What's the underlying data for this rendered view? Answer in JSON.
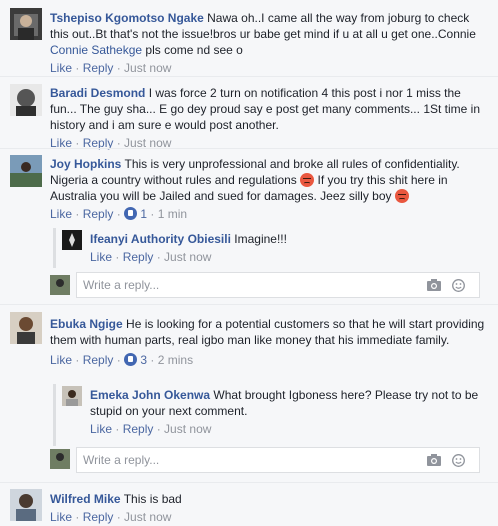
{
  "comments": [
    {
      "name": "Tshepiso Kgomotso Ngake",
      "text": "Nawa oh..I came all the way from joburg to check this out..Bt that's not the issue!bros ur babe get mind if u at all u get one..Connie",
      "mention": "Connie Sathekge",
      "text_after": "pls come nd see o",
      "like": "Like",
      "reply": "Reply",
      "time": "Just now"
    },
    {
      "name": "Baradi Desmond",
      "text": "I was force 2 turn on notification 4 this post i nor 1 miss the fun... The guy sha... E go dey proud say e post get many comments... 1St time in history and i am sure e would post another.",
      "like": "Like",
      "reply": "Reply",
      "time": "Just now"
    },
    {
      "name": "Joy Hopkins",
      "text_a": "This is very unprofessional and broke all rules of confidentiality. Nigeria a country without rules and regulations",
      "text_b": "If you try this shit here in Australia you will be Jailed and sued for damages. Jeez silly boy",
      "like": "Like",
      "reply": "Reply",
      "reactions": "1",
      "time": "1 min",
      "replies": [
        {
          "name": "Ifeanyi Authority Obiesili",
          "text": "Imagine!!!",
          "like": "Like",
          "reply": "Reply",
          "time": "Just now"
        }
      ],
      "reply_placeholder": "Write a reply..."
    },
    {
      "name": "Ebuka Ngige",
      "text": "He is looking for a potential customers so that he will start providing them with human parts, real igbo man like money that his immediate family.",
      "like": "Like",
      "reply": "Reply",
      "reactions": "3",
      "time": "2 mins",
      "replies": [
        {
          "name": "Emeka John Okenwa",
          "text": "What brought Igboness here? Please try not to be stupid on your next comment.",
          "like": "Like",
          "reply": "Reply",
          "time": "Just now"
        }
      ],
      "reply_placeholder": "Write a reply..."
    },
    {
      "name": "Wilfred Mike",
      "text": "This is bad",
      "like": "Like",
      "reply": "Reply",
      "time": "Just now"
    }
  ],
  "icons": {
    "camera": "camera-icon",
    "emoji": "smiley-icon",
    "angry": "angry-emoji-icon",
    "like": "like-reaction-icon"
  },
  "colors": {
    "name": "#365899",
    "link": "#4b67a1",
    "meta": "#90949c"
  }
}
